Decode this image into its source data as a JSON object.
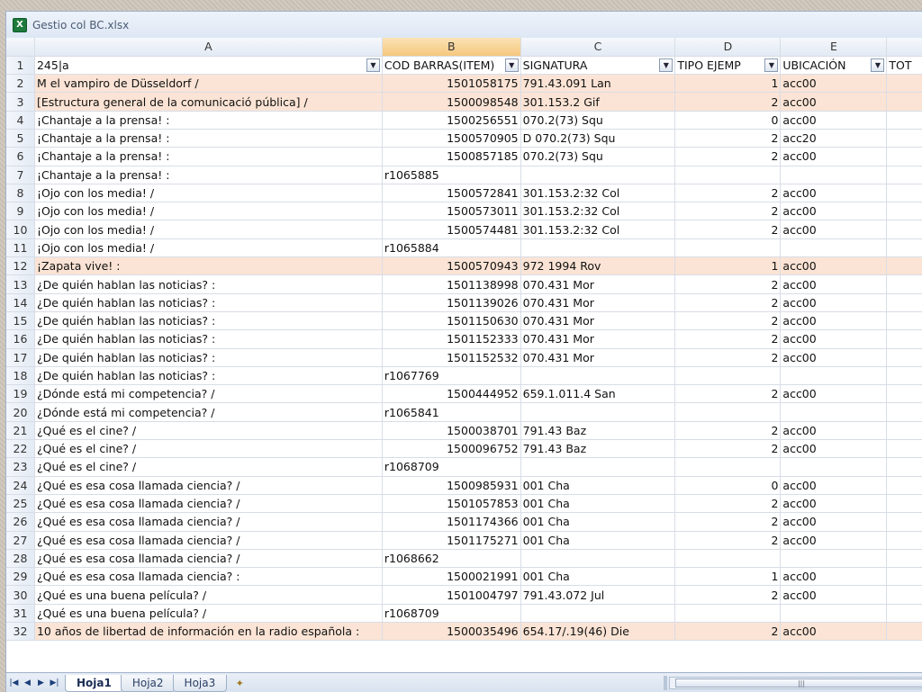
{
  "window": {
    "title": "Gestio col BC.xlsx",
    "app_icon": "excel-icon"
  },
  "columns": [
    {
      "letter": "A",
      "selected": false
    },
    {
      "letter": "B",
      "selected": true
    },
    {
      "letter": "C",
      "selected": false
    },
    {
      "letter": "D",
      "selected": false
    },
    {
      "letter": "E",
      "selected": false
    },
    {
      "letter": "",
      "selected": false
    }
  ],
  "header_row": {
    "row_number": "1",
    "cells": [
      "245|a",
      "COD BARRAS(ITEM)",
      "SIGNATURA",
      "TIPO EJEMP",
      "UBICACIÓN",
      "TOT"
    ]
  },
  "rows": [
    {
      "n": "2",
      "hl": true,
      "a": " M  el vampiro de Düsseldorf /",
      "b": "1501058175",
      "c": "791.43.091 Lan",
      "d": "1",
      "e": "acc00"
    },
    {
      "n": "3",
      "hl": true,
      "a": "[Estructura general de la comunicació pública] /",
      "b": "1500098548",
      "c": "301.153.2 Gif",
      "d": "2",
      "e": "acc00"
    },
    {
      "n": "4",
      "hl": false,
      "a": "¡Chantaje a la prensa! :",
      "b": "1500256551",
      "c": "070.2(73) Squ",
      "d": "0",
      "e": "acc00"
    },
    {
      "n": "5",
      "hl": false,
      "a": "¡Chantaje a la prensa! :",
      "b": "1500570905",
      "c": "D 070.2(73) Squ",
      "d": "2",
      "e": "acc20"
    },
    {
      "n": "6",
      "hl": false,
      "a": "¡Chantaje a la prensa! :",
      "b": "1500857185",
      "c": "070.2(73) Squ",
      "d": "2",
      "e": "acc00"
    },
    {
      "n": "7",
      "hl": false,
      "a": "¡Chantaje a la prensa! :",
      "b": "r1065885",
      "c": "",
      "d": "",
      "e": ""
    },
    {
      "n": "8",
      "hl": false,
      "a": "¡Ojo con los media! /",
      "b": "1500572841",
      "c": "301.153.2:32 Col",
      "d": "2",
      "e": "acc00"
    },
    {
      "n": "9",
      "hl": false,
      "a": "¡Ojo con los media! /",
      "b": "1500573011",
      "c": "301.153.2:32 Col",
      "d": "2",
      "e": "acc00"
    },
    {
      "n": "10",
      "hl": false,
      "a": "¡Ojo con los media! /",
      "b": "1500574481",
      "c": "301.153.2:32 Col",
      "d": "2",
      "e": "acc00"
    },
    {
      "n": "11",
      "hl": false,
      "a": "¡Ojo con los media! /",
      "b": "r1065884",
      "c": "",
      "d": "",
      "e": ""
    },
    {
      "n": "12",
      "hl": true,
      "a": "¡Zapata vive! :",
      "b": "1500570943",
      "c": "972 1994  Rov",
      "d": "1",
      "e": "acc00"
    },
    {
      "n": "13",
      "hl": false,
      "a": "¿De quién hablan las noticias? :",
      "b": "1501138998",
      "c": "070.431 Mor",
      "d": "2",
      "e": "acc00"
    },
    {
      "n": "14",
      "hl": false,
      "a": "¿De quién hablan las noticias? :",
      "b": "1501139026",
      "c": "070.431 Mor",
      "d": "2",
      "e": "acc00"
    },
    {
      "n": "15",
      "hl": false,
      "a": "¿De quién hablan las noticias? :",
      "b": "1501150630",
      "c": "070.431 Mor",
      "d": "2",
      "e": "acc00"
    },
    {
      "n": "16",
      "hl": false,
      "a": "¿De quién hablan las noticias? :",
      "b": "1501152333",
      "c": "070.431 Mor",
      "d": "2",
      "e": "acc00"
    },
    {
      "n": "17",
      "hl": false,
      "a": "¿De quién hablan las noticias? :",
      "b": "1501152532",
      "c": "070.431 Mor",
      "d": "2",
      "e": "acc00"
    },
    {
      "n": "18",
      "hl": false,
      "a": "¿De quién hablan las noticias? :",
      "b": "r1067769",
      "c": "",
      "d": "",
      "e": ""
    },
    {
      "n": "19",
      "hl": false,
      "a": "¿Dónde está mi competencia? /",
      "b": "1500444952",
      "c": "659.1.011.4 San",
      "d": "2",
      "e": "acc00"
    },
    {
      "n": "20",
      "hl": false,
      "a": "¿Dónde está mi competencia? /",
      "b": "r1065841",
      "c": "",
      "d": "",
      "e": ""
    },
    {
      "n": "21",
      "hl": false,
      "a": "¿Qué es el cine? /",
      "b": "1500038701",
      "c": "791.43 Baz",
      "d": "2",
      "e": "acc00"
    },
    {
      "n": "22",
      "hl": false,
      "a": "¿Qué es el cine? /",
      "b": "1500096752",
      "c": "791.43 Baz",
      "d": "2",
      "e": "acc00"
    },
    {
      "n": "23",
      "hl": false,
      "a": "¿Qué es el cine? /",
      "b": "r1068709",
      "c": "",
      "d": "",
      "e": ""
    },
    {
      "n": "24",
      "hl": false,
      "a": "¿Qué es esa cosa llamada ciencia? /",
      "b": "1500985931",
      "c": "001 Cha",
      "d": "0",
      "e": "acc00"
    },
    {
      "n": "25",
      "hl": false,
      "a": "¿Qué es esa cosa llamada ciencia? /",
      "b": "1501057853",
      "c": "001 Cha",
      "d": "2",
      "e": "acc00"
    },
    {
      "n": "26",
      "hl": false,
      "a": "¿Qué es esa cosa llamada ciencia? /",
      "b": "1501174366",
      "c": "001 Cha",
      "d": "2",
      "e": "acc00"
    },
    {
      "n": "27",
      "hl": false,
      "a": "¿Qué es esa cosa llamada ciencia? /",
      "b": "1501175271",
      "c": "001 Cha",
      "d": "2",
      "e": "acc00"
    },
    {
      "n": "28",
      "hl": false,
      "a": "¿Qué es esa cosa llamada ciencia? /",
      "b": "r1068662",
      "c": "",
      "d": "",
      "e": ""
    },
    {
      "n": "29",
      "hl": false,
      "a": "¿Qué es esa cosa llamada ciencia? :",
      "b": "1500021991",
      "c": "001 Cha",
      "d": "1",
      "e": "acc00"
    },
    {
      "n": "30",
      "hl": false,
      "a": "¿Qué es una buena película? /",
      "b": "1501004797",
      "c": "791.43.072 Jul",
      "d": "2",
      "e": "acc00"
    },
    {
      "n": "31",
      "hl": false,
      "a": "¿Qué es una buena película? /",
      "b": "r1068709",
      "c": "",
      "d": "",
      "e": ""
    },
    {
      "n": "32",
      "hl": true,
      "a": "10 años de libertad de información en la radio española :",
      "b": "1500035496",
      "c": "654.17/.19(46) Die",
      "d": "2",
      "e": "acc00"
    }
  ],
  "sheet_tabs": [
    {
      "label": "Hoja1",
      "active": true
    },
    {
      "label": "Hoja2",
      "active": false
    },
    {
      "label": "Hoja3",
      "active": false
    }
  ],
  "colors": {
    "highlight_row": "#fbe4d5",
    "selected_col": "#f5c77e",
    "grid_line": "#d8dde6"
  }
}
